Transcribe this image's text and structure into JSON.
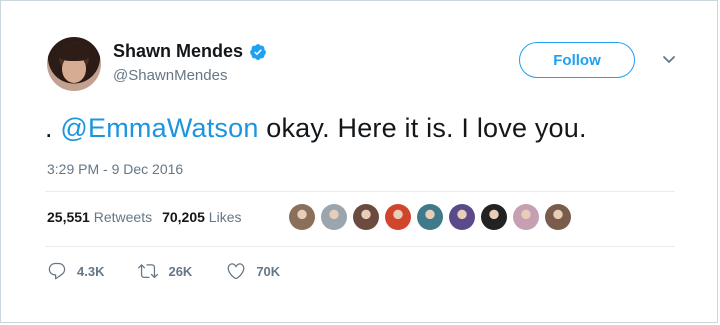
{
  "user": {
    "name": "Shawn Mendes",
    "handle": "@ShawnMendes",
    "verified": true
  },
  "follow_button": {
    "label": "Follow"
  },
  "tweet": {
    "prefix": ". ",
    "mention": "@EmmaWatson",
    "text": " okay. Here it is. I love you.",
    "timestamp": "3:29 PM - 9 Dec 2016"
  },
  "stats": {
    "retweets_count": "25,551",
    "retweets_label": "Retweets",
    "likes_count": "70,205",
    "likes_label": "Likes"
  },
  "actions": {
    "reply_count": "4.3K",
    "retweet_count": "26K",
    "like_count": "70K"
  },
  "colors": {
    "accent": "#1da1f2",
    "mention": "#1b95e0",
    "text": "#14171a",
    "muted": "#657786"
  },
  "liker_avatars": [
    {
      "icon": "liker-avatar-1",
      "color": "#8a6f5a"
    },
    {
      "icon": "liker-avatar-2",
      "color": "#9aa5ad"
    },
    {
      "icon": "liker-avatar-3",
      "color": "#6b4b3e"
    },
    {
      "icon": "liker-avatar-4",
      "color": "#d1452c"
    },
    {
      "icon": "liker-avatar-5",
      "color": "#3e7a8a"
    },
    {
      "icon": "liker-avatar-6",
      "color": "#5b4a8a"
    },
    {
      "icon": "liker-avatar-7",
      "color": "#222222"
    },
    {
      "icon": "liker-avatar-8",
      "color": "#c79fb3"
    },
    {
      "icon": "liker-avatar-9",
      "color": "#7a5c4c"
    }
  ]
}
